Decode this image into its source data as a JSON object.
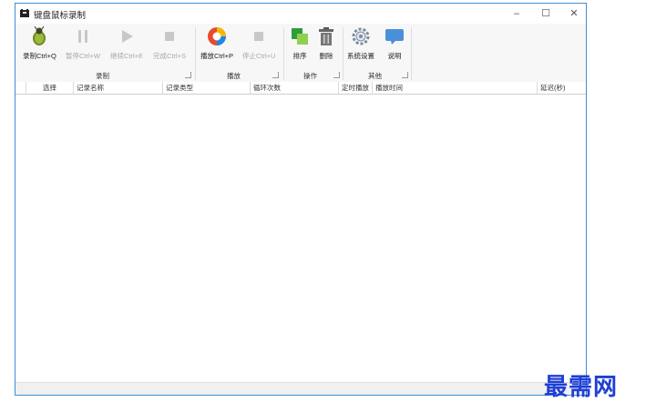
{
  "window": {
    "title": "键盘鼠标录制",
    "minimize": "–",
    "maximize": "☐",
    "close": "✕"
  },
  "toolbar": {
    "record": "录制Ctrl+Q",
    "pause": "暂停Ctrl+W",
    "continue": "继续Ctrl+E",
    "finish": "完成Ctrl+S",
    "play": "播放Ctrl+P",
    "stop": "停止Ctrl+U",
    "sort": "排序",
    "delete": "删除",
    "settings": "系统设置",
    "help": "说明"
  },
  "groups": {
    "record": "录制",
    "play": "播放",
    "operate": "操作",
    "other": "其他"
  },
  "columns": {
    "select": "选择",
    "name": "记录名称",
    "type": "记录类型",
    "loops": "循环次数",
    "timed": "定时播放",
    "time": "播放时间",
    "delay": "延迟(秒)"
  },
  "watermark": "最需网",
  "colors": {
    "window_border": "#3c8fd8",
    "watermark": "#1f3fd6"
  }
}
